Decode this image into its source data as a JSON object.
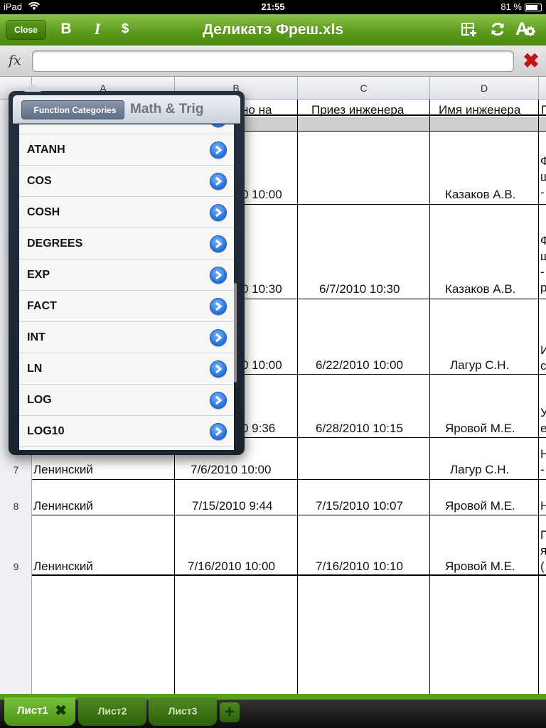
{
  "status": {
    "device": "iPad",
    "time": "21:55",
    "battery_text": "81 %",
    "battery_level": 0.81
  },
  "toolbar": {
    "close_label": "Close",
    "bold_label": "B",
    "italic_label": "I",
    "currency_label": "$",
    "title": "Деликатэ Фреш.xls",
    "font_label": "A"
  },
  "formula": {
    "fx_label": "fx",
    "value": ""
  },
  "columns": [
    {
      "label": "A"
    },
    {
      "label": "B"
    },
    {
      "label": "C"
    },
    {
      "label": "D"
    }
  ],
  "header_row": {
    "b": "но на",
    "c": "Приез инженера",
    "d": "Имя инженера",
    "e": "П"
  },
  "rows": [
    {
      "num": "",
      "a": "",
      "b": "0 10:00",
      "c": "",
      "d": "Казаков А.В.",
      "e": "Ф ш -"
    },
    {
      "num": "",
      "a": "",
      "b": "0 10:30",
      "c": "6/7/2010 10:30",
      "d": "Казаков А.В.",
      "e": "Ф ш - р"
    },
    {
      "num": "",
      "a": "",
      "b": "0 10:00",
      "c": "6/22/2010 10:00",
      "d": "Лагур  С.Н.",
      "e": "И с"
    },
    {
      "num": "",
      "a": "",
      "b": "0 9:36",
      "c": "6/28/2010 10:15",
      "d": "Яровой М.Е.",
      "e": "У е"
    },
    {
      "num": "7",
      "a": "Ленинский",
      "b": "7/6/2010 10:00",
      "c": "",
      "d": "Лагур  С.Н.",
      "e": "Н -"
    },
    {
      "num": "8",
      "a": "Ленинский",
      "b": "7/15/2010 9:44",
      "c": "7/15/2010 10:07",
      "d": "Яровой М.Е.",
      "e": "Н"
    },
    {
      "num": "9",
      "a": "Ленинский",
      "b": "7/16/2010 10:00",
      "c": "7/16/2010 10:10",
      "d": "Яровой М.Е.",
      "e": "П я ("
    }
  ],
  "popover": {
    "back_label": "Function Categories",
    "title": "Math & Trig",
    "items": [
      "ATANH",
      "COS",
      "COSH",
      "DEGREES",
      "EXP",
      "FACT",
      "INT",
      "LN",
      "LOG",
      "LOG10"
    ]
  },
  "sheets": {
    "tabs": [
      {
        "label": "Лист1"
      },
      {
        "label": "Лист2"
      },
      {
        "label": "Лист3"
      }
    ],
    "close_label": "✖",
    "add_label": "+"
  }
}
